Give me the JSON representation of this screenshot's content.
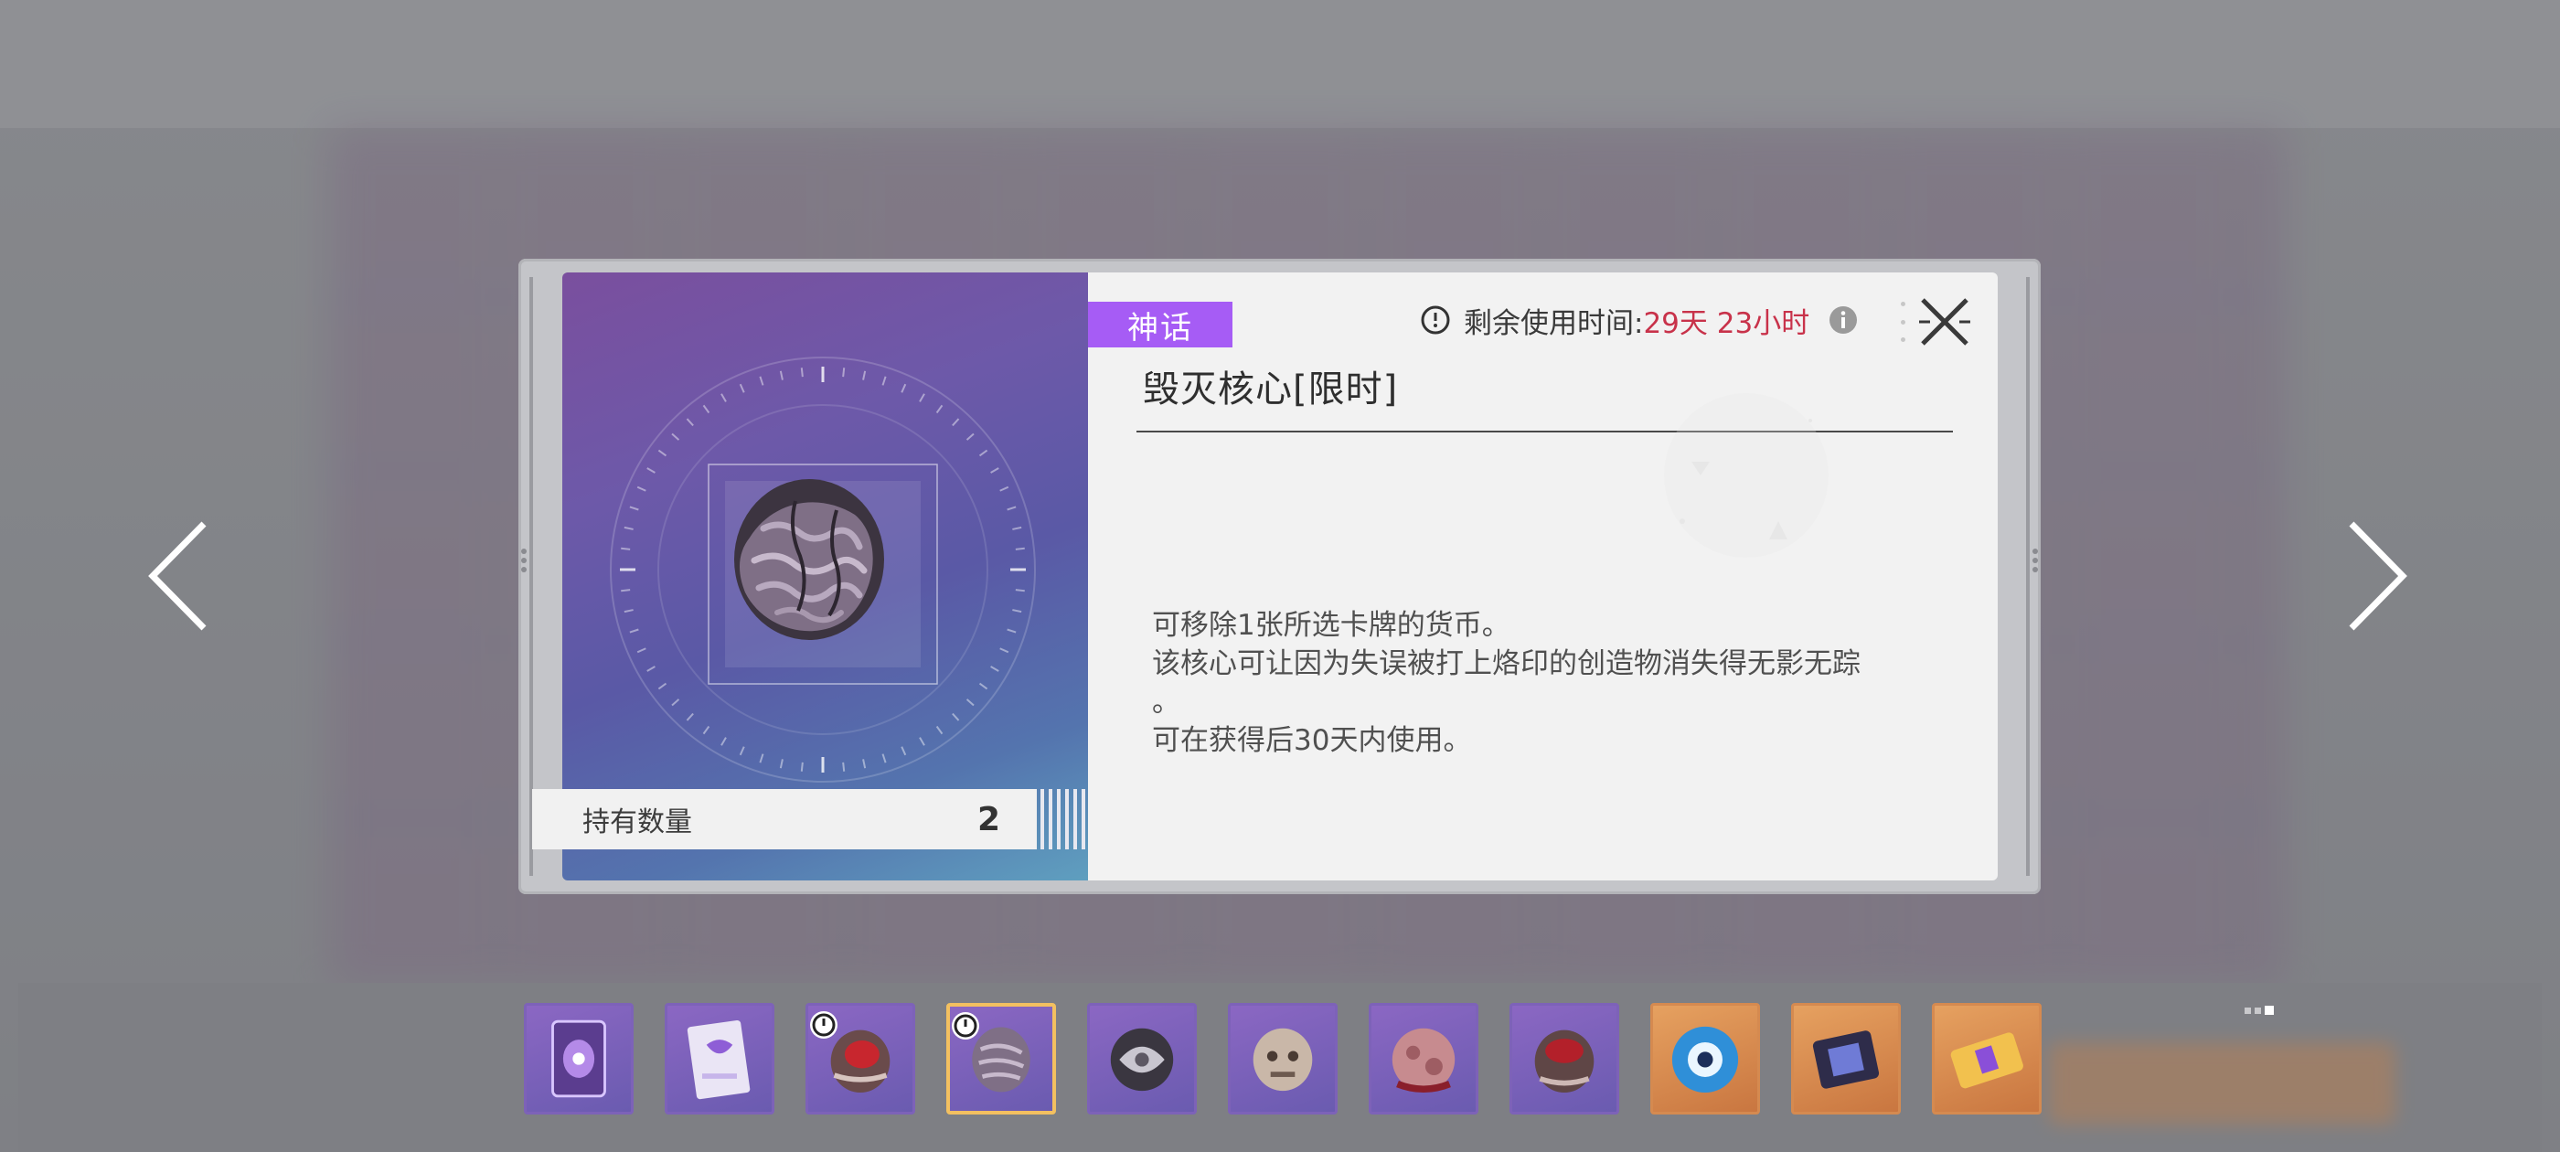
{
  "item": {
    "rarity": "神话",
    "name": "毁灭核心[限时]",
    "timer_label": "剩余使用时间:",
    "timer_value": "29天 23小时",
    "holding_label": "持有数量",
    "holding_count": "2",
    "description": [
      "可移除1张所选卡牌的货币。",
      "该核心可让因为失误被打上烙印的创造物消失得无影无踪",
      "。",
      "可在获得后30天内使用。"
    ]
  },
  "colors": {
    "rarity_bg": "#a65cf5",
    "timer_value": "#c8324a",
    "slot_purple": "#7d62b8",
    "slot_orange": "#d58a50",
    "slot_selected": "#f3c060"
  },
  "icons": {
    "prev": "chevron-left-icon",
    "next": "chevron-right-icon",
    "close": "close-x-icon",
    "timer": "clock-icon",
    "info": "info-icon"
  },
  "item_bar": [
    {
      "name": "card-back-item",
      "frame": "purple",
      "timed": false,
      "selected": false
    },
    {
      "name": "card-pack-item",
      "frame": "purple",
      "timed": false,
      "selected": false
    },
    {
      "name": "red-core-item",
      "frame": "purple",
      "timed": true,
      "selected": false
    },
    {
      "name": "destruction-core-item",
      "frame": "purple",
      "timed": true,
      "selected": true
    },
    {
      "name": "silver-orb-item",
      "frame": "purple",
      "timed": false,
      "selected": false
    },
    {
      "name": "stone-head-item",
      "frame": "purple",
      "timed": false,
      "selected": false
    },
    {
      "name": "flesh-orb-item",
      "frame": "purple",
      "timed": false,
      "selected": false
    },
    {
      "name": "red-core-item-2",
      "frame": "purple",
      "timed": false,
      "selected": false
    },
    {
      "name": "blue-eye-item",
      "frame": "orange",
      "timed": false,
      "selected": false
    },
    {
      "name": "chip-item",
      "frame": "orange",
      "timed": false,
      "selected": false
    },
    {
      "name": "ticket-item",
      "frame": "orange",
      "timed": false,
      "selected": false
    }
  ]
}
